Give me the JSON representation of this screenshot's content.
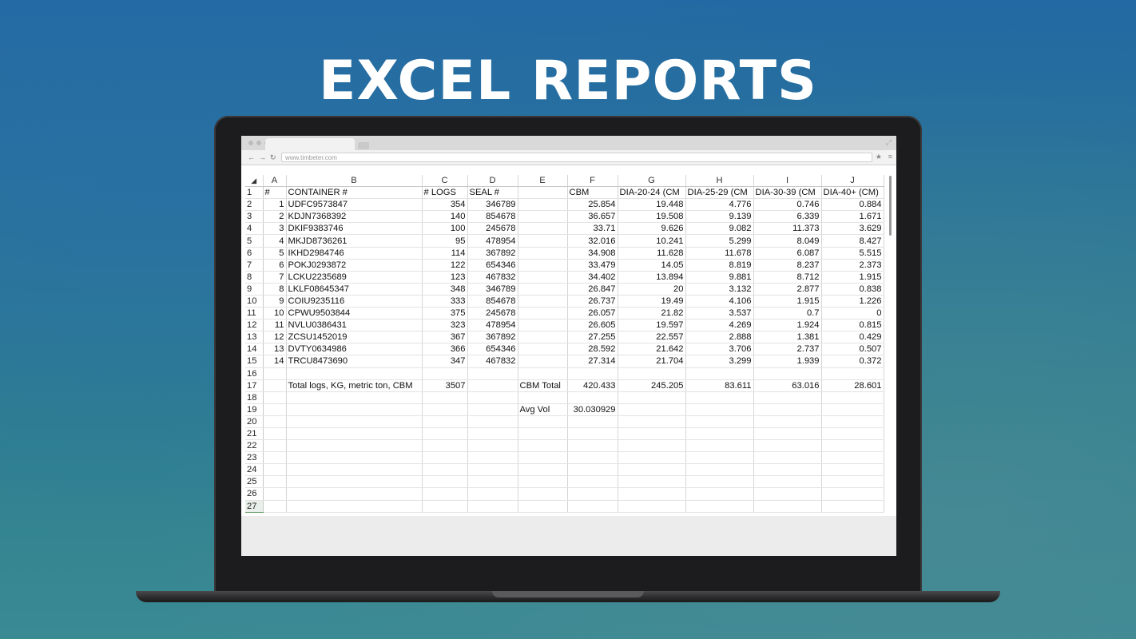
{
  "hero": {
    "title": "EXCEL REPORTS"
  },
  "browser": {
    "url": "www.timbeter.com",
    "icons": {
      "back": "back-arrow-icon",
      "forward": "forward-arrow-icon",
      "reload": "reload-icon",
      "star": "star-icon",
      "menu": "menu-icon",
      "expand": "expand-icon"
    }
  },
  "sheet": {
    "corner": "◢",
    "columns": [
      "A",
      "B",
      "C",
      "D",
      "E",
      "F",
      "G",
      "H",
      "I",
      "J"
    ],
    "selected_row": 27,
    "rows": [
      [
        "1",
        "#",
        "CONTAINER #",
        "# LOGS",
        "SEAL #",
        "",
        "CBM",
        "DIA-20-24 (CM",
        "DIA-25-29 (CM",
        "DIA-30-39 (CM",
        "DIA-40+ (CM)"
      ],
      [
        "2",
        "1",
        "UDFC9573847",
        "354",
        "346789",
        "",
        "25.854",
        "19.448",
        "4.776",
        "0.746",
        "0.884"
      ],
      [
        "3",
        "2",
        "KDJN7368392",
        "140",
        "854678",
        "",
        "36.657",
        "19.508",
        "9.139",
        "6.339",
        "1.671"
      ],
      [
        "4",
        "3",
        "DKIF9383746",
        "100",
        "245678",
        "",
        "33.71",
        "9.626",
        "9.082",
        "11.373",
        "3.629"
      ],
      [
        "5",
        "4",
        "MKJD8736261",
        "95",
        "478954",
        "",
        "32.016",
        "10.241",
        "5.299",
        "8.049",
        "8.427"
      ],
      [
        "6",
        "5",
        "IKHD2984746",
        "114",
        "367892",
        "",
        "34.908",
        "11.628",
        "11.678",
        "6.087",
        "5.515"
      ],
      [
        "7",
        "6",
        "POKJ0293872",
        "122",
        "654346",
        "",
        "33.479",
        "14.05",
        "8.819",
        "8.237",
        "2.373"
      ],
      [
        "8",
        "7",
        "LCKU2235689",
        "123",
        "467832",
        "",
        "34.402",
        "13.894",
        "9.881",
        "8.712",
        "1.915"
      ],
      [
        "9",
        "8",
        "LKLF08645347",
        "348",
        "346789",
        "",
        "26.847",
        "20",
        "3.132",
        "2.877",
        "0.838"
      ],
      [
        "10",
        "9",
        "COIU9235116",
        "333",
        "854678",
        "",
        "26.737",
        "19.49",
        "4.106",
        "1.915",
        "1.226"
      ],
      [
        "11",
        "10",
        "CPWU9503844",
        "375",
        "245678",
        "",
        "26.057",
        "21.82",
        "3.537",
        "0.7",
        "0"
      ],
      [
        "12",
        "11",
        "NVLU0386431",
        "323",
        "478954",
        "",
        "26.605",
        "19.597",
        "4.269",
        "1.924",
        "0.815"
      ],
      [
        "13",
        "12",
        "ZCSU1452019",
        "367",
        "367892",
        "",
        "27.255",
        "22.557",
        "2.888",
        "1.381",
        "0.429"
      ],
      [
        "14",
        "13",
        "DVTY0634986",
        "366",
        "654346",
        "",
        "28.592",
        "21.642",
        "3.706",
        "2.737",
        "0.507"
      ],
      [
        "15",
        "14",
        "TRCU8473690",
        "347",
        "467832",
        "",
        "27.314",
        "21.704",
        "3.299",
        "1.939",
        "0.372"
      ],
      [
        "16",
        "",
        "",
        "",
        "",
        "",
        "",
        "",
        "",
        "",
        ""
      ],
      [
        "17",
        "",
        "Total logs, KG, metric ton, CBM",
        "3507",
        "",
        "CBM Total",
        "420.433",
        "245.205",
        "83.611",
        "63.016",
        "28.601"
      ],
      [
        "18",
        "",
        "",
        "",
        "",
        "",
        "",
        "",
        "",
        "",
        ""
      ],
      [
        "19",
        "",
        "",
        "",
        "",
        "Avg Vol",
        "30.030929",
        "",
        "",
        "",
        ""
      ],
      [
        "20",
        "",
        "",
        "",
        "",
        "",
        "",
        "",
        "",
        "",
        ""
      ],
      [
        "21",
        "",
        "",
        "",
        "",
        "",
        "",
        "",
        "",
        "",
        ""
      ],
      [
        "22",
        "",
        "",
        "",
        "",
        "",
        "",
        "",
        "",
        "",
        ""
      ],
      [
        "23",
        "",
        "",
        "",
        "",
        "",
        "",
        "",
        "",
        "",
        ""
      ],
      [
        "24",
        "",
        "",
        "",
        "",
        "",
        "",
        "",
        "",
        "",
        ""
      ],
      [
        "25",
        "",
        "",
        "",
        "",
        "",
        "",
        "",
        "",
        "",
        ""
      ],
      [
        "26",
        "",
        "",
        "",
        "",
        "",
        "",
        "",
        "",
        "",
        ""
      ],
      [
        "27",
        "",
        "",
        "",
        "",
        "",
        "",
        "",
        "",
        "",
        ""
      ]
    ]
  }
}
